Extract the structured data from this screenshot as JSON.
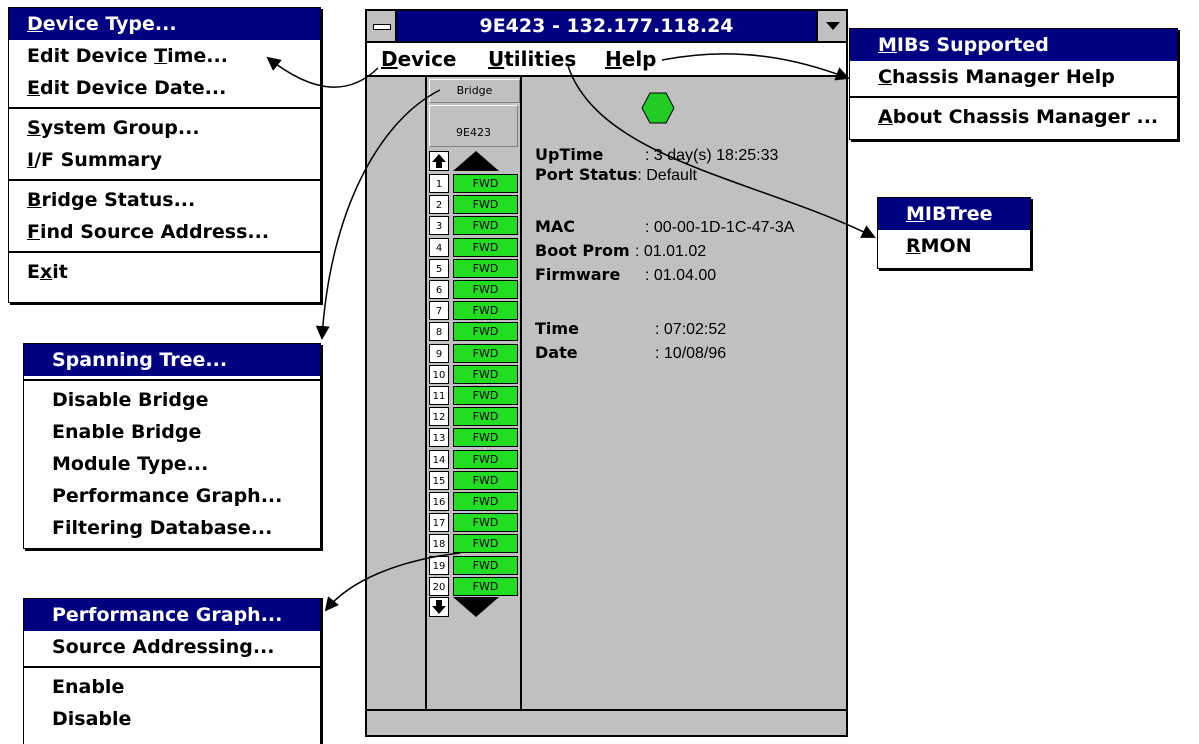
{
  "window": {
    "title": "9E423 - 132.177.118.24",
    "menubar": [
      {
        "pre": "",
        "u": "D",
        "post": "evice"
      },
      {
        "pre": "",
        "u": "U",
        "post": "tilities"
      },
      {
        "pre": "",
        "u": "H",
        "post": "elp"
      }
    ],
    "bridge_label": "Bridge",
    "module_label": "9E423",
    "ports": [
      {
        "n": "1",
        "s": "FWD"
      },
      {
        "n": "2",
        "s": "FWD"
      },
      {
        "n": "3",
        "s": "FWD"
      },
      {
        "n": "4",
        "s": "FWD"
      },
      {
        "n": "5",
        "s": "FWD"
      },
      {
        "n": "6",
        "s": "FWD"
      },
      {
        "n": "7",
        "s": "FWD"
      },
      {
        "n": "8",
        "s": "FWD"
      },
      {
        "n": "9",
        "s": "FWD"
      },
      {
        "n": "10",
        "s": "FWD"
      },
      {
        "n": "11",
        "s": "FWD"
      },
      {
        "n": "12",
        "s": "FWD"
      },
      {
        "n": "13",
        "s": "FWD"
      },
      {
        "n": "14",
        "s": "FWD"
      },
      {
        "n": "15",
        "s": "FWD"
      },
      {
        "n": "16",
        "s": "FWD"
      },
      {
        "n": "17",
        "s": "FWD"
      },
      {
        "n": "18",
        "s": "FWD"
      },
      {
        "n": "19",
        "s": "FWD"
      },
      {
        "n": "20",
        "s": "FWD"
      }
    ],
    "info": {
      "uptime_label": "UpTime",
      "uptime_value": ": 3 day(s) 18:25:33",
      "portstatus_label": "Port Status",
      "portstatus_value": ": Default",
      "mac_label": "MAC",
      "mac_value": ": 00-00-1D-1C-47-3A",
      "bootprom_label": "Boot Prom",
      "bootprom_value": ": 01.01.02",
      "firmware_label": "Firmware",
      "firmware_value": ": 01.04.00",
      "time_label": "Time",
      "time_value": ": 07:02:52",
      "date_label": "Date",
      "date_value": ": 10/08/96"
    }
  },
  "device_menu": {
    "items": [
      {
        "pre": "",
        "u": "D",
        "post": "evice Type...",
        "hl": true
      },
      {
        "pre": "Edit Device ",
        "u": "T",
        "post": "ime..."
      },
      {
        "pre": "",
        "u": "E",
        "post": "dit Device Date..."
      },
      {
        "sep": true
      },
      {
        "pre": "",
        "u": "S",
        "post": "ystem Group..."
      },
      {
        "pre": "",
        "u": "I",
        "post": "/F Summary"
      },
      {
        "sep": true
      },
      {
        "pre": "",
        "u": "B",
        "post": "ridge Status..."
      },
      {
        "pre": "",
        "u": "F",
        "post": "ind Source Address..."
      },
      {
        "sep": true
      },
      {
        "pre": "E",
        "u": "x",
        "post": "it"
      }
    ]
  },
  "bridge_menu": {
    "items": [
      {
        "label": "Spanning Tree...",
        "hl": true
      },
      {
        "sep": true
      },
      {
        "label": "Disable Bridge"
      },
      {
        "label": "Enable Bridge"
      },
      {
        "label": "Module Type..."
      },
      {
        "label": "Performance Graph..."
      },
      {
        "label": "Filtering Database..."
      }
    ]
  },
  "port_menu": {
    "items": [
      {
        "label": "Performance Graph...",
        "hl": true
      },
      {
        "label": "Source Addressing..."
      },
      {
        "sep": true
      },
      {
        "label": "Enable"
      },
      {
        "label": "Disable"
      }
    ]
  },
  "help_menu": {
    "items": [
      {
        "pre": "",
        "u": "M",
        "post": "IBs Supported",
        "hl": true
      },
      {
        "pre": "",
        "u": "C",
        "post": "hassis Manager Help"
      },
      {
        "sep": true
      },
      {
        "pre": "",
        "u": "A",
        "post": "bout Chassis Manager ..."
      }
    ]
  },
  "utilities_menu": {
    "items": [
      {
        "pre": "",
        "u": "M",
        "post": "IBTree",
        "hl": true
      },
      {
        "pre": "",
        "u": "R",
        "post": "MON"
      }
    ]
  },
  "colors": {
    "highlight": "#000080",
    "port_ok": "#22dd22",
    "led": "#22cc22",
    "window_bg": "#c0c0c0"
  }
}
